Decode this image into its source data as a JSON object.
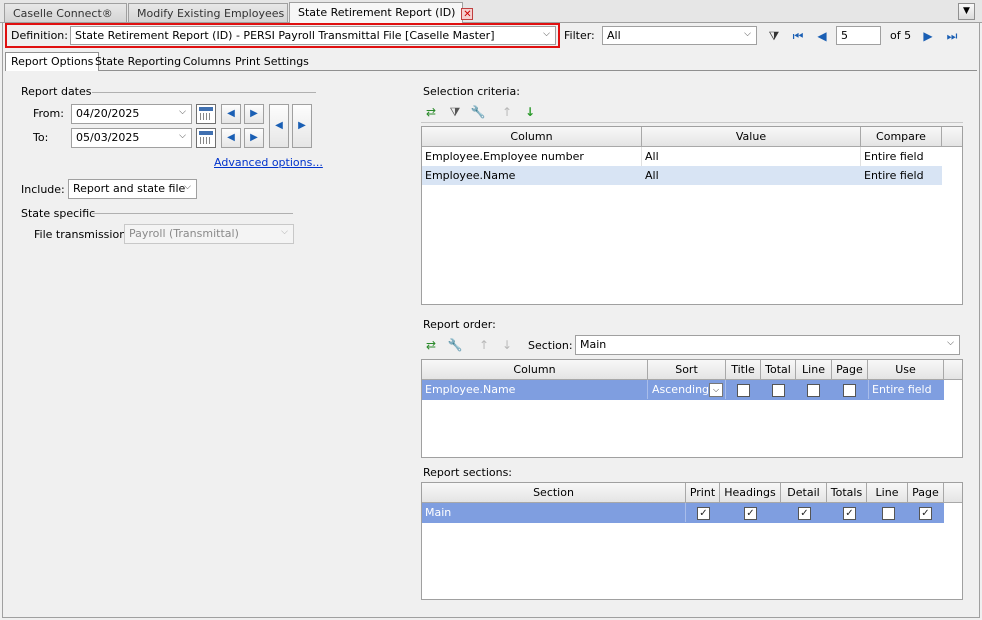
{
  "top_tabs": [
    {
      "label": "Caselle Connect®"
    },
    {
      "label": "Modify Existing Employees"
    },
    {
      "label": "State Retirement Report (ID)"
    }
  ],
  "definition": {
    "label": "Definition:",
    "value": "State Retirement Report (ID) - PERSI Payroll Transmittal File [Caselle Master]"
  },
  "filter": {
    "label": "Filter:",
    "value": "All"
  },
  "pager": {
    "current": "5",
    "of_label": "of 5"
  },
  "section_tabs": [
    "Report Options",
    "State Reporting",
    "Columns",
    "Print Settings"
  ],
  "report_dates": {
    "title": "Report dates",
    "from_label": "From:",
    "from_value": "04/20/2025",
    "to_label": "To:",
    "to_value": "05/03/2025",
    "advanced_link": "Advanced options..."
  },
  "include": {
    "label": "Include:",
    "value": "Report and state file"
  },
  "state_specific": {
    "title": "State specific",
    "file_transmission_label": "File transmission:",
    "file_transmission_value": "Payroll (Transmittal)"
  },
  "selection_criteria": {
    "title": "Selection criteria:",
    "headers": [
      "Column",
      "Value",
      "Compare"
    ],
    "rows": [
      {
        "column": "Employee.Employee number",
        "value": "All",
        "compare": "Entire field"
      },
      {
        "column": "Employee.Name",
        "value": "All",
        "compare": "Entire field"
      }
    ]
  },
  "report_order": {
    "title": "Report order:",
    "section_label": "Section:",
    "section_value": "Main",
    "headers": [
      "Column",
      "Sort",
      "Title",
      "Total",
      "Line",
      "Page",
      "Use"
    ],
    "rows": [
      {
        "column": "Employee.Name",
        "sort": "Ascending",
        "use": "Entire field"
      }
    ]
  },
  "report_sections": {
    "title": "Report sections:",
    "headers": [
      "Section",
      "Print",
      "Headings",
      "Detail",
      "Totals",
      "Line",
      "Page"
    ],
    "rows": [
      {
        "section": "Main"
      }
    ]
  },
  "colors": {
    "highlight_red": "#e01010",
    "row_select_light": "#d8e4f4",
    "row_select_blue": "#7f9ee0",
    "link_blue": "#0033cc"
  }
}
